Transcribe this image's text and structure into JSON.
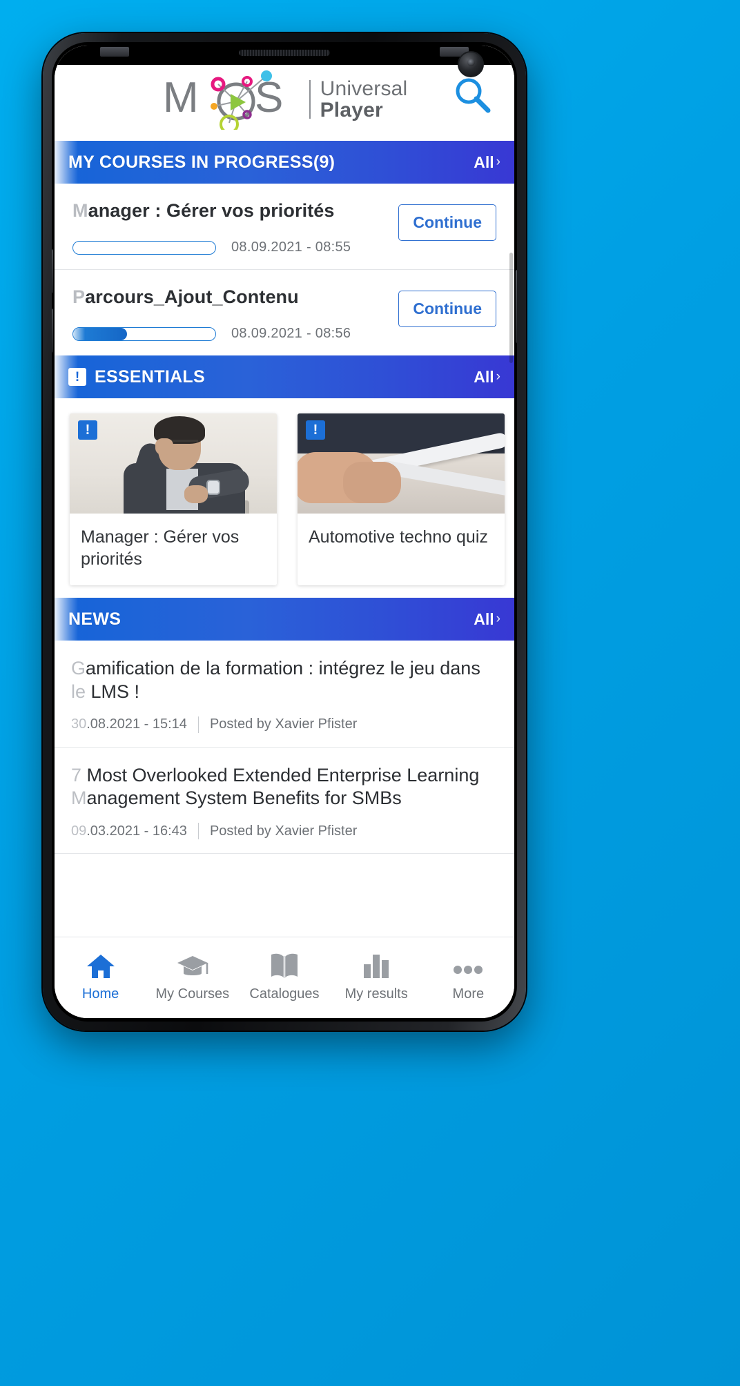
{
  "app": {
    "logo_line1": "Universal",
    "logo_line2": "Player",
    "search_icon": "search-icon",
    "camera_icon": "front-camera"
  },
  "sections": {
    "courses": {
      "title": "MY COURSES IN PROGRESS(9)",
      "all_label": "All",
      "all_chevron": "›"
    },
    "essentials": {
      "title": "ESSENTIALS",
      "badge": "!",
      "all_label": "All",
      "all_chevron": "›"
    },
    "news": {
      "title": "NEWS",
      "all_label": "All",
      "all_chevron": "›"
    }
  },
  "courses": [
    {
      "title_initial": "M",
      "title_rest": "anager : Gérer vos priorités",
      "progress_percent": 0,
      "date": "08.09.2021  -  08:55",
      "action_label": "Continue"
    },
    {
      "title_initial": "P",
      "title_rest": "arcours_Ajout_Contenu",
      "progress_percent": 38,
      "date": "08.09.2021  -  08:56",
      "action_label": "Continue"
    }
  ],
  "essential_cards": [
    {
      "badge": "!",
      "title": "Manager : Gérer vos priorités",
      "image_alt": "businessman-checking-watch-at-laptop"
    },
    {
      "badge": "!",
      "title": "Automotive techno quiz",
      "image_alt": "hands-holding-white-tube"
    }
  ],
  "news_items": [
    {
      "title_initial": "G",
      "title_rest": "amification de la formation : intégrez le jeu dans",
      "title_line2_initial": "le",
      "title_line2_rest": " LMS !",
      "date_initial": "30",
      "date_rest": ".08.2021  -  15:14",
      "author": "Posted by Xavier Pfister"
    },
    {
      "title_initial": "7",
      "title_rest": " Most Overlooked Extended Enterprise Learning",
      "title_line2_initial": "M",
      "title_line2_rest": "anagement System Benefits for SMBs",
      "date_initial": "09",
      "date_rest": ".03.2021  -  16:43",
      "author": "Posted by Xavier Pfister"
    }
  ],
  "bottom_nav": [
    {
      "label": "Home",
      "icon": "home-icon",
      "active": true
    },
    {
      "label": "My Courses",
      "icon": "graduation-cap-icon",
      "active": false
    },
    {
      "label": "Catalogues",
      "icon": "book-icon",
      "active": false
    },
    {
      "label": "My results",
      "icon": "bar-chart-icon",
      "active": false
    },
    {
      "label": "More",
      "icon": "ellipsis-icon",
      "active": false
    }
  ],
  "colors": {
    "accent_blue": "#1C6FD6",
    "bar_gradient_start": "#1565D8",
    "bar_gradient_end": "#3838D4",
    "background": "#00A3E0"
  }
}
